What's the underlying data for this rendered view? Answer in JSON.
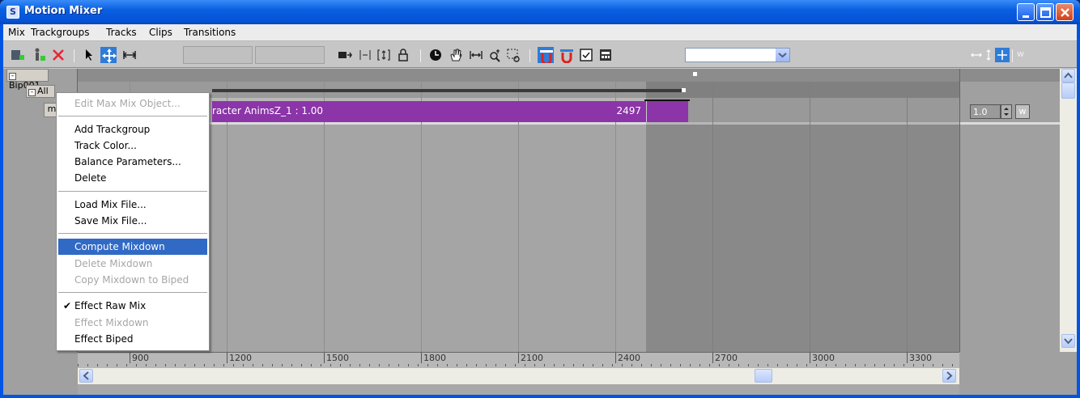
{
  "window": {
    "title": "Motion Mixer",
    "app_icon": "max-logo-icon"
  },
  "menubar": {
    "items": [
      "Mix",
      "Trackgroups",
      "Tracks",
      "Clips",
      "Transitions"
    ]
  },
  "toolbar": {
    "filter_value": "",
    "weight_label": "w"
  },
  "tree": {
    "root": "Bip001",
    "group": "All",
    "track": "m"
  },
  "clip": {
    "label": "racter AnimsZ_1 : 1.00",
    "end_frame": "2497",
    "color": "#8b35a8"
  },
  "weight": {
    "value": "1.0",
    "w_label": "w"
  },
  "ruler": {
    "ticks": [
      "900",
      "1200",
      "1500",
      "1800",
      "2100",
      "2400",
      "2700",
      "3000",
      "3300"
    ]
  },
  "context_menu": {
    "items": [
      {
        "label": "Edit Max Mix Object...",
        "state": "disabled"
      },
      {
        "label": "Add Trackgroup",
        "state": "normal"
      },
      {
        "label": "Track Color...",
        "state": "normal"
      },
      {
        "label": "Balance Parameters...",
        "state": "normal"
      },
      {
        "label": "Delete",
        "state": "normal"
      },
      {
        "label": "Load Mix File...",
        "state": "normal"
      },
      {
        "label": "Save Mix File...",
        "state": "normal"
      },
      {
        "label": "Compute Mixdown",
        "state": "selected"
      },
      {
        "label": "Delete Mixdown",
        "state": "disabled"
      },
      {
        "label": "Copy Mixdown to Biped",
        "state": "disabled"
      },
      {
        "label": "Effect Raw Mix",
        "state": "checked"
      },
      {
        "label": "Effect Mixdown",
        "state": "disabled"
      },
      {
        "label": "Effect Biped",
        "state": "normal"
      }
    ]
  }
}
